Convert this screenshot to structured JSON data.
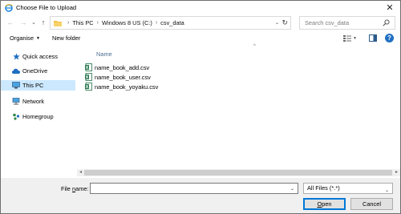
{
  "window": {
    "title": "Choose File to Upload",
    "close_glyph": "✕"
  },
  "address": {
    "back_glyph": "←",
    "forward_glyph": "→",
    "recent_glyph": "⌄",
    "up_glyph": "↑",
    "crumbs": [
      "This PC",
      "Windows 8 US (C:)",
      "csv_data"
    ],
    "separator": "›",
    "dropdown_glyph": "⌄",
    "refresh_glyph": "↻"
  },
  "search": {
    "placeholder": "Search csv_data"
  },
  "toolbar": {
    "organise_label": "Organise",
    "new_folder_label": "New folder",
    "caret_glyph": "▼",
    "help_glyph": "?"
  },
  "nav_pane": {
    "items": [
      {
        "label": "Quick access",
        "icon": "star-icon",
        "color": "#1f6fc1"
      },
      {
        "label": "OneDrive",
        "icon": "cloud-icon",
        "color": "#1f6fc1"
      },
      {
        "label": "This PC",
        "icon": "computer-icon",
        "color": "#3a7bd5",
        "selected": true
      },
      {
        "label": "Network",
        "icon": "network-icon",
        "color": "#3a7bd5"
      },
      {
        "label": "Homegroup",
        "icon": "homegroup-icon",
        "color": "#2d8a4a"
      }
    ]
  },
  "file_list": {
    "sort_glyph": "^",
    "column_name": "Name",
    "files": [
      {
        "name": "name_book_add.csv",
        "icon": "excel-csv-icon"
      },
      {
        "name": "name_book_user.csv",
        "icon": "excel-csv-icon"
      },
      {
        "name": "name_book_yoyaku.csv",
        "icon": "excel-csv-icon"
      }
    ]
  },
  "scrollbar": {
    "left_glyph": "◂",
    "right_glyph": "▸"
  },
  "bottom": {
    "file_name_label_prefix": "File ",
    "file_name_label_mnemonic": "n",
    "file_name_label_suffix": "ame:",
    "file_name_value": "",
    "file_type_filter": "All Files (*.*)",
    "dropdown_glyph": "⌄",
    "open_mnemonic": "O",
    "open_rest": "pen",
    "cancel_label": "Cancel"
  },
  "colors": {
    "accent": "#0078d7",
    "selection": "#cce8ff",
    "header_text": "#4b6e93"
  }
}
